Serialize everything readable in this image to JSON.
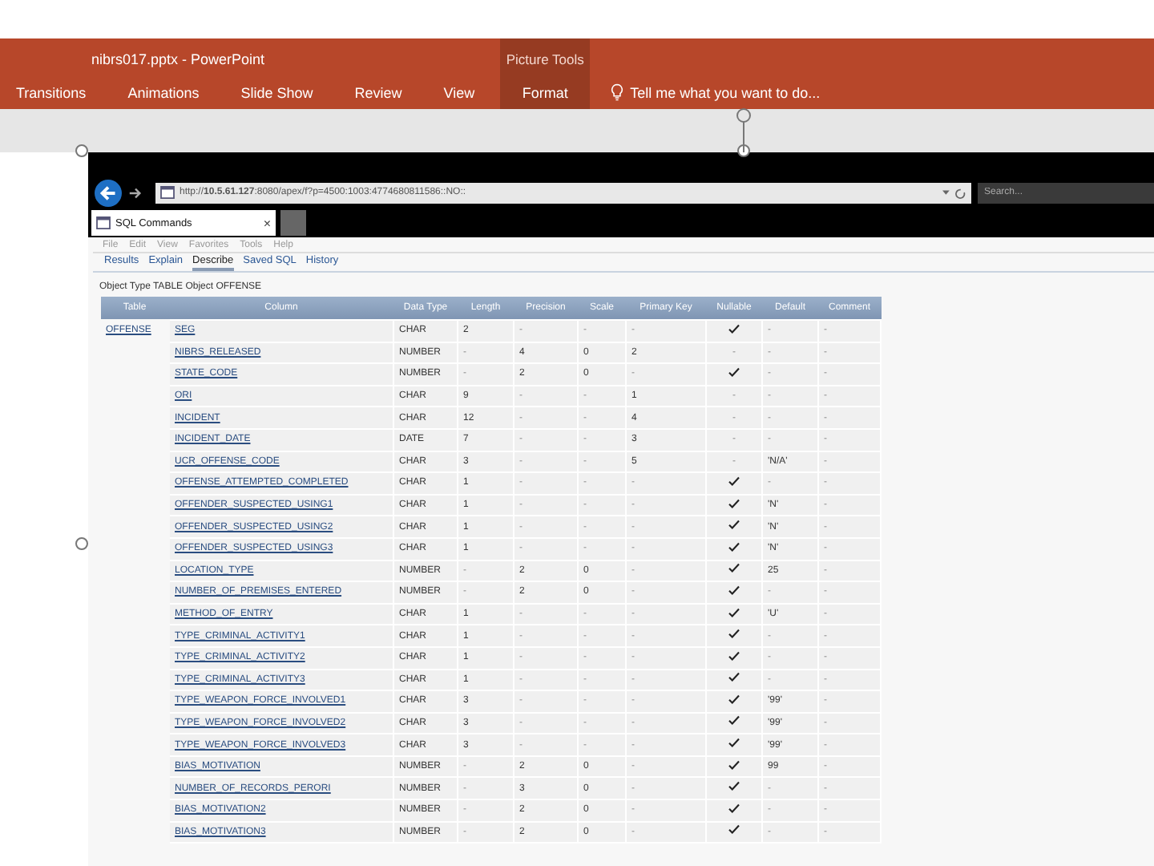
{
  "window": {
    "title": "nibrs017.pptx - PowerPoint"
  },
  "ribbon": {
    "tabs": [
      {
        "label": "Transitions",
        "selected": false
      },
      {
        "label": "Animations",
        "selected": false
      },
      {
        "label": "Slide Show",
        "selected": false
      },
      {
        "label": "Review",
        "selected": false
      },
      {
        "label": "View",
        "selected": false
      }
    ],
    "contextual": {
      "group": "Picture Tools",
      "tab": {
        "label": "Format",
        "selected": true
      }
    },
    "tell_me": {
      "placeholder": "Tell me what you want to do..."
    }
  },
  "browser": {
    "address": {
      "prefix": "http://",
      "host": "10.5.61.127",
      "rest": ":8080/apex/f?p=4500:1003:4774680811586::NO::"
    },
    "search": {
      "placeholder": "Search..."
    },
    "tab": {
      "label": "SQL Commands",
      "close": "×"
    },
    "menu": [
      "File",
      "Edit",
      "View",
      "Favorites",
      "Tools",
      "Help"
    ]
  },
  "apex": {
    "tabs": [
      {
        "label": "Results",
        "selected": false
      },
      {
        "label": "Explain",
        "selected": false
      },
      {
        "label": "Describe",
        "selected": true
      },
      {
        "label": "Saved SQL",
        "selected": false
      },
      {
        "label": "History",
        "selected": false
      }
    ],
    "object_line": "Object Type  TABLE Object  OFFENSE",
    "table": {
      "columns": [
        "Table",
        "Column",
        "Data Type",
        "Length",
        "Precision",
        "Scale",
        "Primary Key",
        "Nullable",
        "Default",
        "Comment"
      ],
      "rows": [
        {
          "table": "OFFENSE",
          "column": "SEG",
          "data_type": "CHAR",
          "length": "2",
          "precision": "-",
          "scale": "-",
          "primary_key": "-",
          "nullable": true,
          "default": "-",
          "comment": "-"
        },
        {
          "column": "NIBRS_RELEASED",
          "data_type": "NUMBER",
          "length": "-",
          "precision": "4",
          "scale": "0",
          "primary_key": "2",
          "nullable": false,
          "nullable_mark": "-",
          "default": "-",
          "comment": "-"
        },
        {
          "column": "STATE_CODE",
          "data_type": "NUMBER",
          "length": "-",
          "precision": "2",
          "scale": "0",
          "primary_key": "-",
          "nullable": true,
          "default": "-",
          "comment": "-"
        },
        {
          "column": "ORI",
          "data_type": "CHAR",
          "length": "9",
          "precision": "-",
          "scale": "-",
          "primary_key": "1",
          "nullable": false,
          "nullable_mark": "-",
          "default": "-",
          "comment": "-"
        },
        {
          "column": "INCIDENT",
          "data_type": "CHAR",
          "length": "12",
          "precision": "-",
          "scale": "-",
          "primary_key": "4",
          "nullable": false,
          "nullable_mark": "-",
          "default": "-",
          "comment": "-"
        },
        {
          "column": "INCIDENT_DATE",
          "data_type": "DATE",
          "length": "7",
          "precision": "-",
          "scale": "-",
          "primary_key": "3",
          "nullable": false,
          "nullable_mark": "-",
          "default": "-",
          "comment": "-"
        },
        {
          "column": "UCR_OFFENSE_CODE",
          "data_type": "CHAR",
          "length": "3",
          "precision": "-",
          "scale": "-",
          "primary_key": "5",
          "nullable": false,
          "nullable_mark": "-",
          "default": "'N/A'",
          "comment": "-"
        },
        {
          "column": "OFFENSE_ATTEMPTED_COMPLETED",
          "data_type": "CHAR",
          "length": "1",
          "precision": "-",
          "scale": "-",
          "primary_key": "-",
          "nullable": true,
          "default": "-",
          "comment": "-"
        },
        {
          "column": "OFFENDER_SUSPECTED_USING1",
          "data_type": "CHAR",
          "length": "1",
          "precision": "-",
          "scale": "-",
          "primary_key": "-",
          "nullable": true,
          "default": "'N'",
          "comment": "-"
        },
        {
          "column": "OFFENDER_SUSPECTED_USING2",
          "data_type": "CHAR",
          "length": "1",
          "precision": "-",
          "scale": "-",
          "primary_key": "-",
          "nullable": true,
          "default": "'N'",
          "comment": "-"
        },
        {
          "column": "OFFENDER_SUSPECTED_USING3",
          "data_type": "CHAR",
          "length": "1",
          "precision": "-",
          "scale": "-",
          "primary_key": "-",
          "nullable": true,
          "default": "'N'",
          "comment": "-"
        },
        {
          "column": "LOCATION_TYPE",
          "data_type": "NUMBER",
          "length": "-",
          "precision": "2",
          "scale": "0",
          "primary_key": "-",
          "nullable": true,
          "default": "25",
          "comment": "-"
        },
        {
          "column": "NUMBER_OF_PREMISES_ENTERED",
          "data_type": "NUMBER",
          "length": "-",
          "precision": "2",
          "scale": "0",
          "primary_key": "-",
          "nullable": true,
          "default": "-",
          "comment": "-"
        },
        {
          "column": "METHOD_OF_ENTRY",
          "data_type": "CHAR",
          "length": "1",
          "precision": "-",
          "scale": "-",
          "primary_key": "-",
          "nullable": true,
          "default": "'U'",
          "comment": "-"
        },
        {
          "column": "TYPE_CRIMINAL_ACTIVITY1",
          "data_type": "CHAR",
          "length": "1",
          "precision": "-",
          "scale": "-",
          "primary_key": "-",
          "nullable": true,
          "default": "-",
          "comment": "-"
        },
        {
          "column": "TYPE_CRIMINAL_ACTIVITY2",
          "data_type": "CHAR",
          "length": "1",
          "precision": "-",
          "scale": "-",
          "primary_key": "-",
          "nullable": true,
          "default": "-",
          "comment": "-"
        },
        {
          "column": "TYPE_CRIMINAL_ACTIVITY3",
          "data_type": "CHAR",
          "length": "1",
          "precision": "-",
          "scale": "-",
          "primary_key": "-",
          "nullable": true,
          "default": "-",
          "comment": "-"
        },
        {
          "column": "TYPE_WEAPON_FORCE_INVOLVED1",
          "data_type": "CHAR",
          "length": "3",
          "precision": "-",
          "scale": "-",
          "primary_key": "-",
          "nullable": true,
          "default": "'99'",
          "comment": "-"
        },
        {
          "column": "TYPE_WEAPON_FORCE_INVOLVED2",
          "data_type": "CHAR",
          "length": "3",
          "precision": "-",
          "scale": "-",
          "primary_key": "-",
          "nullable": true,
          "default": "'99'",
          "comment": "-"
        },
        {
          "column": "TYPE_WEAPON_FORCE_INVOLVED3",
          "data_type": "CHAR",
          "length": "3",
          "precision": "-",
          "scale": "-",
          "primary_key": "-",
          "nullable": true,
          "default": "'99'",
          "comment": "-"
        },
        {
          "column": "BIAS_MOTIVATION",
          "data_type": "NUMBER",
          "length": "-",
          "precision": "2",
          "scale": "0",
          "primary_key": "-",
          "nullable": true,
          "default": "99",
          "comment": "-"
        },
        {
          "column": "NUMBER_OF_RECORDS_PERORI",
          "data_type": "NUMBER",
          "length": "-",
          "precision": "3",
          "scale": "0",
          "primary_key": "-",
          "nullable": true,
          "default": "-",
          "comment": "-"
        },
        {
          "column": "BIAS_MOTIVATION2",
          "data_type": "NUMBER",
          "length": "-",
          "precision": "2",
          "scale": "0",
          "primary_key": "-",
          "nullable": true,
          "default": "-",
          "comment": "-"
        },
        {
          "column": "BIAS_MOTIVATION3",
          "data_type": "NUMBER",
          "length": "-",
          "precision": "2",
          "scale": "0",
          "primary_key": "-",
          "nullable": true,
          "default": "-",
          "comment": "-"
        }
      ]
    }
  }
}
